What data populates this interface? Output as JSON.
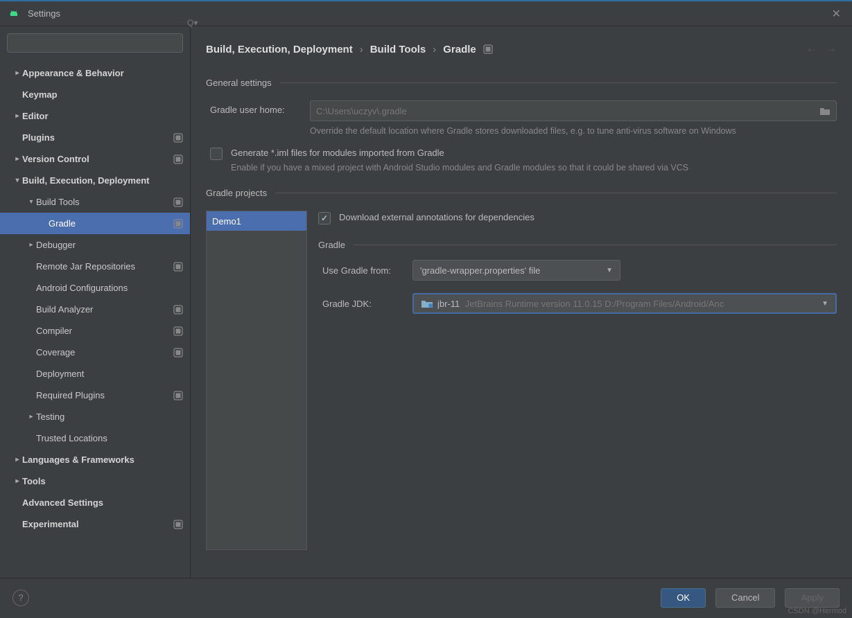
{
  "window": {
    "title": "Settings"
  },
  "search": {
    "placeholder": ""
  },
  "sidebar": {
    "items": [
      {
        "label": "Appearance & Behavior",
        "level": 0,
        "arrow": "right",
        "bold": true
      },
      {
        "label": "Keymap",
        "level": 0,
        "arrow": "",
        "bold": true
      },
      {
        "label": "Editor",
        "level": 0,
        "arrow": "right",
        "bold": true
      },
      {
        "label": "Plugins",
        "level": 0,
        "arrow": "",
        "bold": true,
        "badge": true
      },
      {
        "label": "Version Control",
        "level": 0,
        "arrow": "right",
        "bold": true,
        "badge": true
      },
      {
        "label": "Build, Execution, Deployment",
        "level": 0,
        "arrow": "down",
        "bold": true
      },
      {
        "label": "Build Tools",
        "level": 1,
        "arrow": "down",
        "bold": false,
        "badge": true
      },
      {
        "label": "Gradle",
        "level": 2,
        "arrow": "",
        "bold": false,
        "badge": true,
        "selected": true
      },
      {
        "label": "Debugger",
        "level": 1,
        "arrow": "right",
        "bold": false
      },
      {
        "label": "Remote Jar Repositories",
        "level": 1,
        "arrow": "",
        "bold": false,
        "badge": true
      },
      {
        "label": "Android Configurations",
        "level": 1,
        "arrow": "",
        "bold": false
      },
      {
        "label": "Build Analyzer",
        "level": 1,
        "arrow": "",
        "bold": false,
        "badge": true
      },
      {
        "label": "Compiler",
        "level": 1,
        "arrow": "",
        "bold": false,
        "badge": true
      },
      {
        "label": "Coverage",
        "level": 1,
        "arrow": "",
        "bold": false,
        "badge": true
      },
      {
        "label": "Deployment",
        "level": 1,
        "arrow": "",
        "bold": false
      },
      {
        "label": "Required Plugins",
        "level": 1,
        "arrow": "",
        "bold": false,
        "badge": true
      },
      {
        "label": "Testing",
        "level": 1,
        "arrow": "right",
        "bold": false
      },
      {
        "label": "Trusted Locations",
        "level": 1,
        "arrow": "",
        "bold": false
      },
      {
        "label": "Languages & Frameworks",
        "level": 0,
        "arrow": "right",
        "bold": true
      },
      {
        "label": "Tools",
        "level": 0,
        "arrow": "right",
        "bold": true
      },
      {
        "label": "Advanced Settings",
        "level": 0,
        "arrow": "",
        "bold": true
      },
      {
        "label": "Experimental",
        "level": 0,
        "arrow": "",
        "bold": true,
        "badge": true
      }
    ]
  },
  "breadcrumb": {
    "c1": "Build, Execution, Deployment",
    "c2": "Build Tools",
    "c3": "Gradle"
  },
  "general": {
    "section_title": "General settings",
    "user_home_label": "Gradle user home:",
    "user_home_placeholder": "C:\\Users\\uczyv\\.gradle",
    "user_home_help": "Override the default location where Gradle stores downloaded files, e.g. to tune anti-virus software on Windows",
    "iml_label": "Generate *.iml files for modules imported from Gradle",
    "iml_help": "Enable if you have a mixed project with Android Studio modules and Gradle modules so that it could be shared via VCS"
  },
  "projects": {
    "section_title": "Gradle projects",
    "list": [
      "Demo1"
    ],
    "download_annotations_label": "Download external annotations for dependencies",
    "gradle_sub": "Gradle",
    "use_from_label": "Use Gradle from:",
    "use_from_value": "'gradle-wrapper.properties' file",
    "jdk_label": "Gradle JDK:",
    "jdk_name": "jbr-11",
    "jdk_detail": "JetBrains Runtime version 11.0.15 D:/Program Files/Android/Anc"
  },
  "footer": {
    "ok": "OK",
    "cancel": "Cancel",
    "apply": "Apply"
  },
  "watermark": "CSDN @Hermod"
}
